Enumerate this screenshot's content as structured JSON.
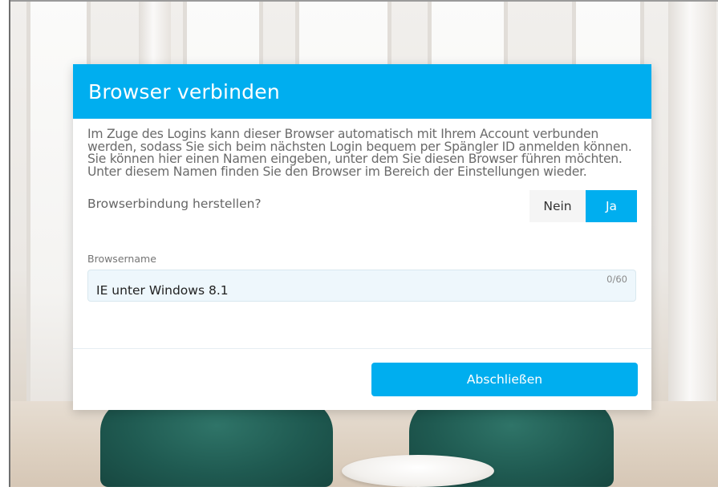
{
  "dialog": {
    "title": "Browser verbinden",
    "intro": "Im Zuge des Logins kann dieser Browser automatisch mit Ihrem Account verbunden werden, sodass Sie sich beim nächsten Login bequem per Spängler ID anmelden können. Sie können hier einen Namen eingeben, unter dem Sie diesen Browser führen möchten. Unter diesem Namen finden Sie den Browser im Bereich der Einstellungen wieder.",
    "question": "Browserbindung herstellen?",
    "toggle": {
      "no_label": "Nein",
      "yes_label": "Ja",
      "selected": "Ja"
    },
    "browsername": {
      "label": "Browsername",
      "value": "IE unter Windows 8.1",
      "counter": "0/60"
    },
    "submit_label": "Abschließen"
  },
  "colors": {
    "accent": "#00aeef",
    "toggle_inactive_bg": "#f5f5f5",
    "field_bg": "#eef7fc"
  }
}
